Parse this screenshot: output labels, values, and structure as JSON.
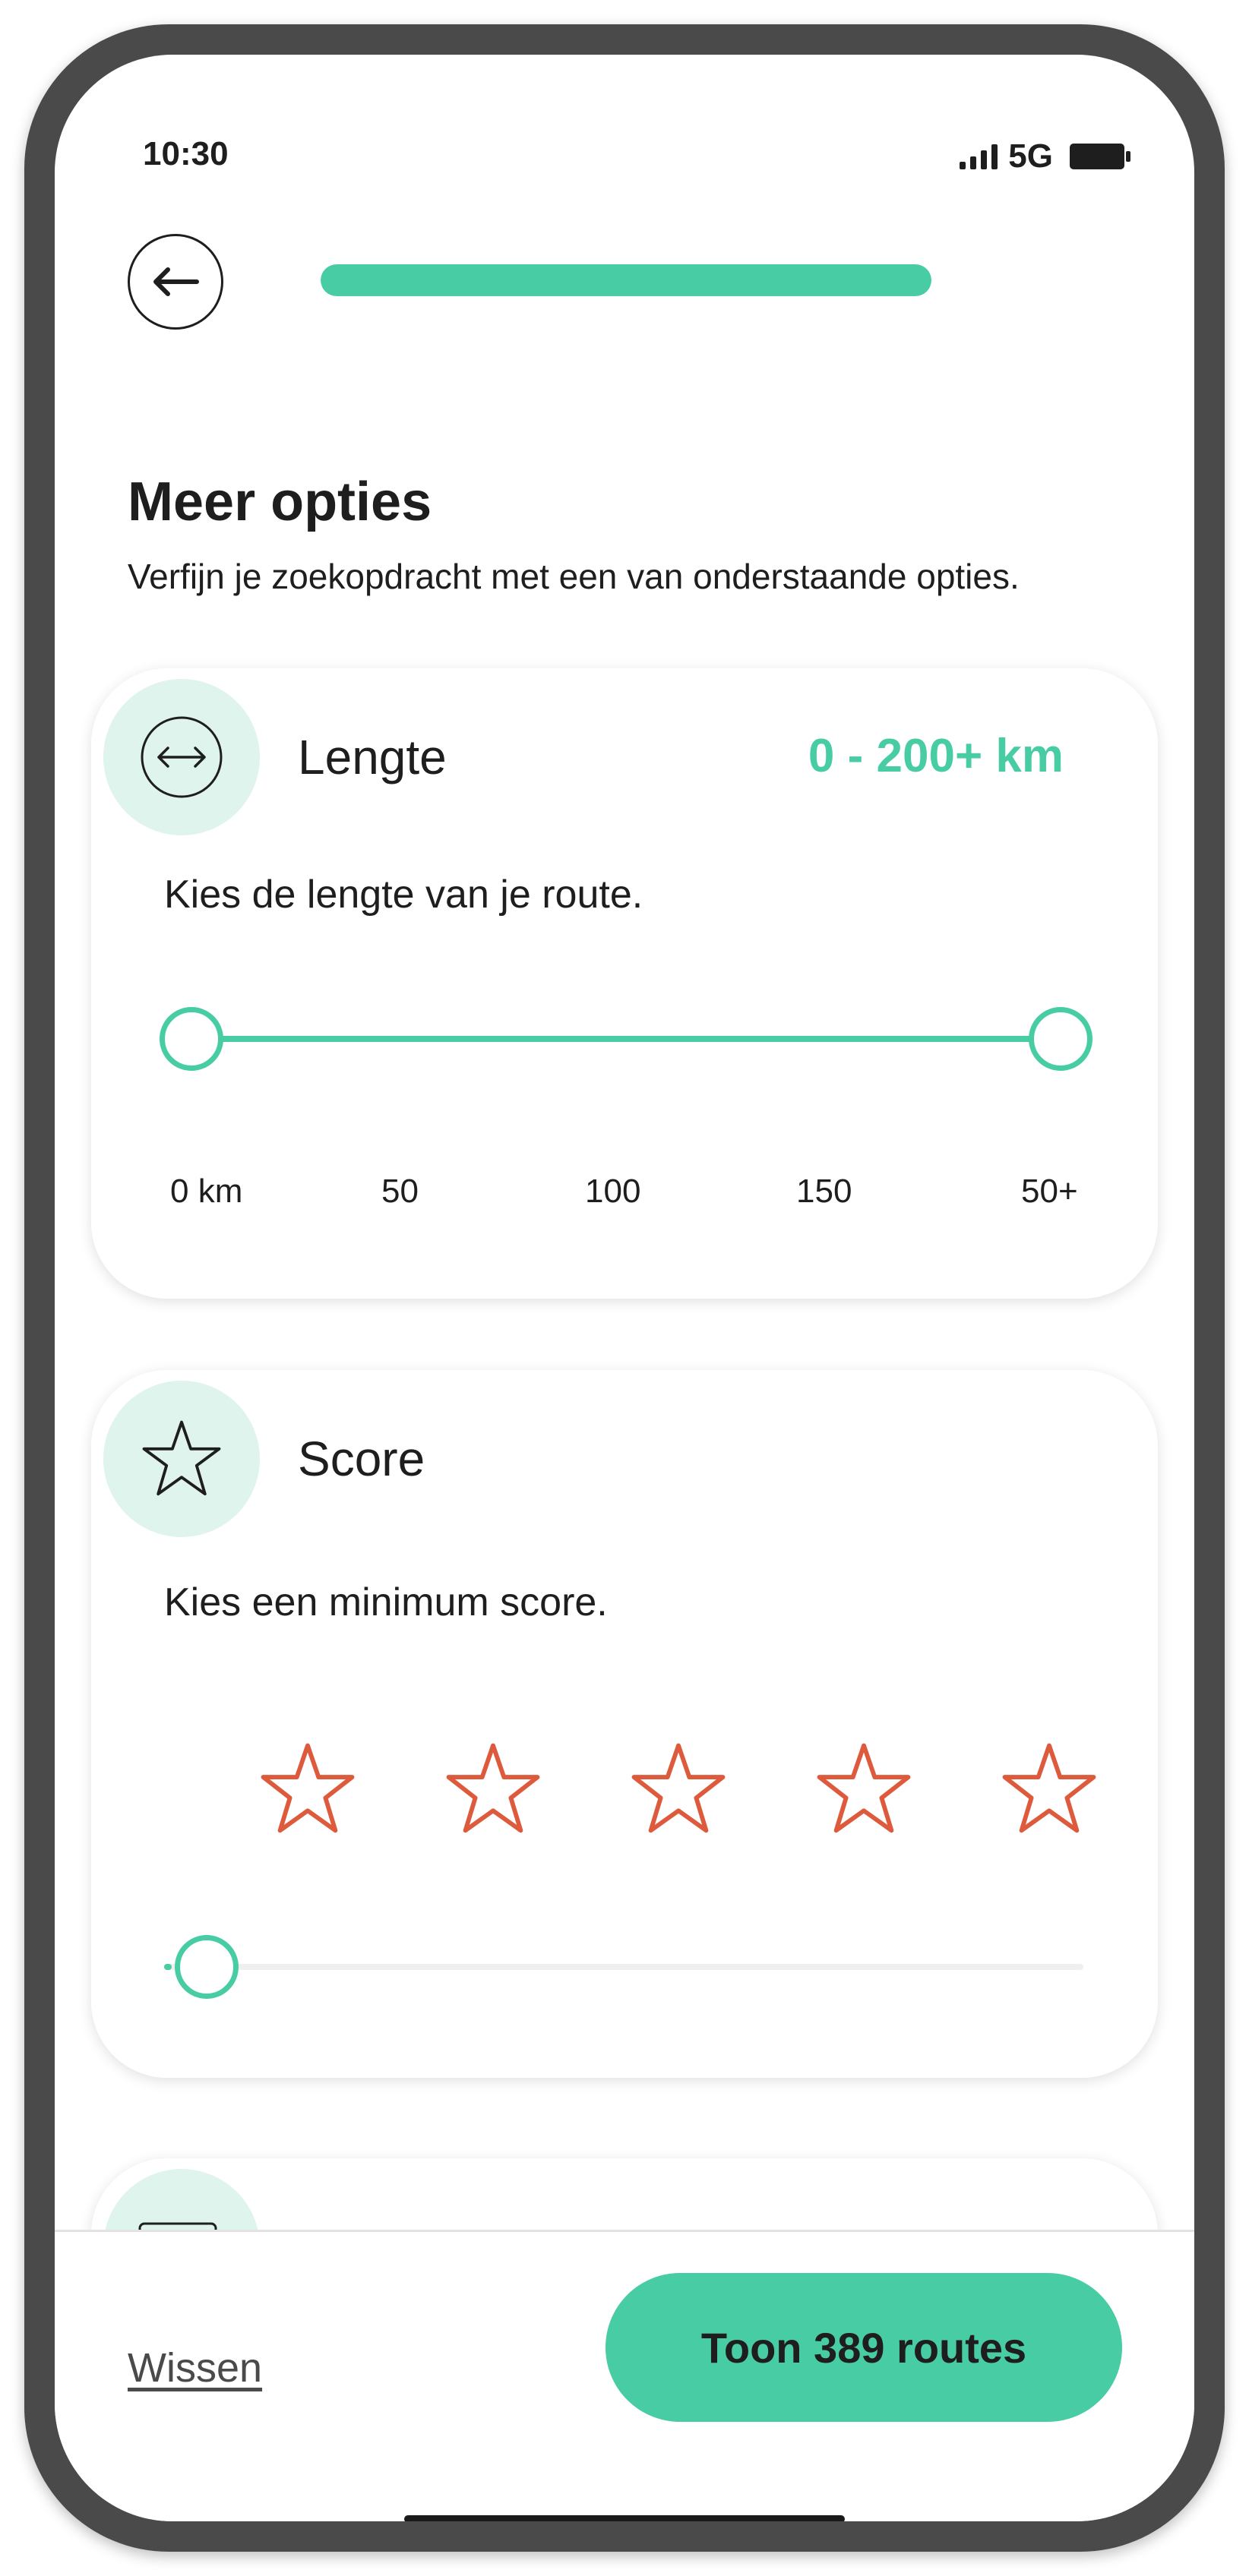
{
  "status_bar": {
    "time": "10:30",
    "network": "5G"
  },
  "header": {
    "progress": 1.0
  },
  "page": {
    "title": "Meer opties",
    "subtitle": "Verfijn je zoekopdracht met een van onderstaande opties."
  },
  "length_card": {
    "icon": "arrows-horizontal-icon",
    "title": "Lengte",
    "value": "0 - 200+ km",
    "description": "Kies de lengte van je route.",
    "range": {
      "min": 0,
      "max": 1
    },
    "ticks": [
      "0 km",
      "50",
      "100",
      "150",
      "50+"
    ]
  },
  "score_card": {
    "icon": "star-outline-icon",
    "title": "Score",
    "description": "Kies een minimum score.",
    "stars_total": 5,
    "selected": 0,
    "star_color": "#de5a3c"
  },
  "footer": {
    "clear_label": "Wissen",
    "show_label": "Toon 389 routes"
  },
  "colors": {
    "accent": "#48cca4",
    "accent_light": "#e0f4ee",
    "text": "#1e1e1e"
  }
}
